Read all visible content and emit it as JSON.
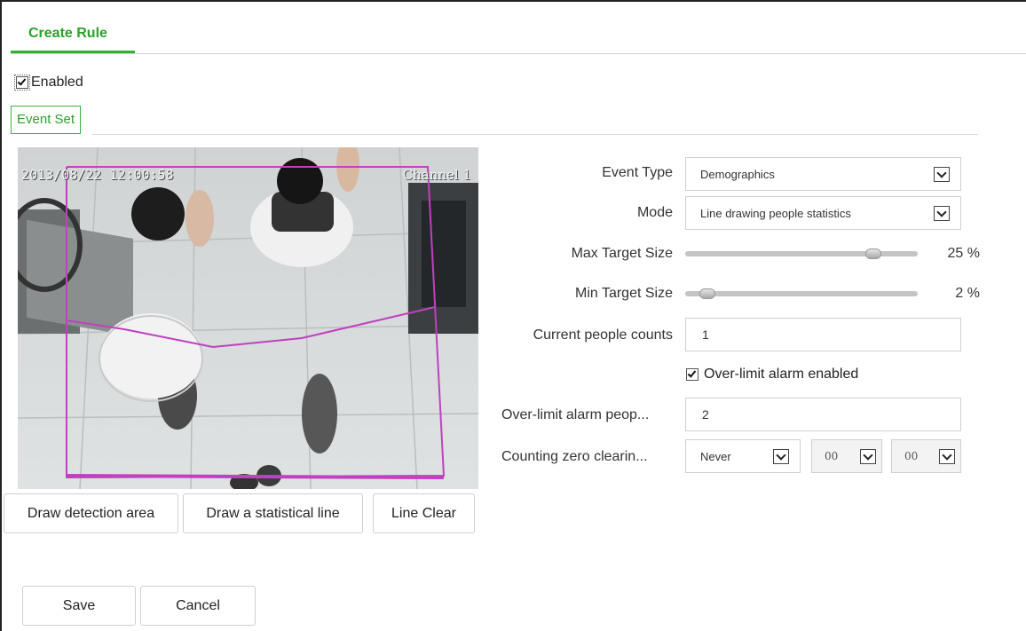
{
  "header": {
    "tab_label": "Create Rule"
  },
  "enabled": {
    "label": "Enabled",
    "checked": true
  },
  "event_set": {
    "label": "Event Set"
  },
  "video": {
    "timestamp": "2013/08/22 12:00:58",
    "channel": "Channel 1",
    "overlay_color": "#c040c0"
  },
  "video_buttons": {
    "draw_area": "Draw detection area",
    "draw_line": "Draw a statistical line",
    "line_clear": "Line Clear"
  },
  "form": {
    "event_type": {
      "label": "Event Type",
      "value": "Demographics"
    },
    "mode": {
      "label": "Mode",
      "value": "Line drawing people statistics"
    },
    "max_target": {
      "label": "Max Target Size",
      "value": 25,
      "display": "25  %"
    },
    "min_target": {
      "label": "Min Target Size",
      "value": 2,
      "display": "2  %"
    },
    "current_counts": {
      "label": "Current people counts",
      "value": "1"
    },
    "over_limit_enabled": {
      "label": "Over-limit alarm enabled",
      "checked": true
    },
    "over_limit_people": {
      "label": "Over-limit alarm peop...",
      "value": "2"
    },
    "zero_clearing": {
      "label": "Counting zero clearin...",
      "value": "Never",
      "hour": "00",
      "minute": "00"
    }
  },
  "actions": {
    "save": "Save",
    "cancel": "Cancel"
  },
  "colors": {
    "accent": "#2fb32f",
    "overlay": "#c040c0"
  }
}
